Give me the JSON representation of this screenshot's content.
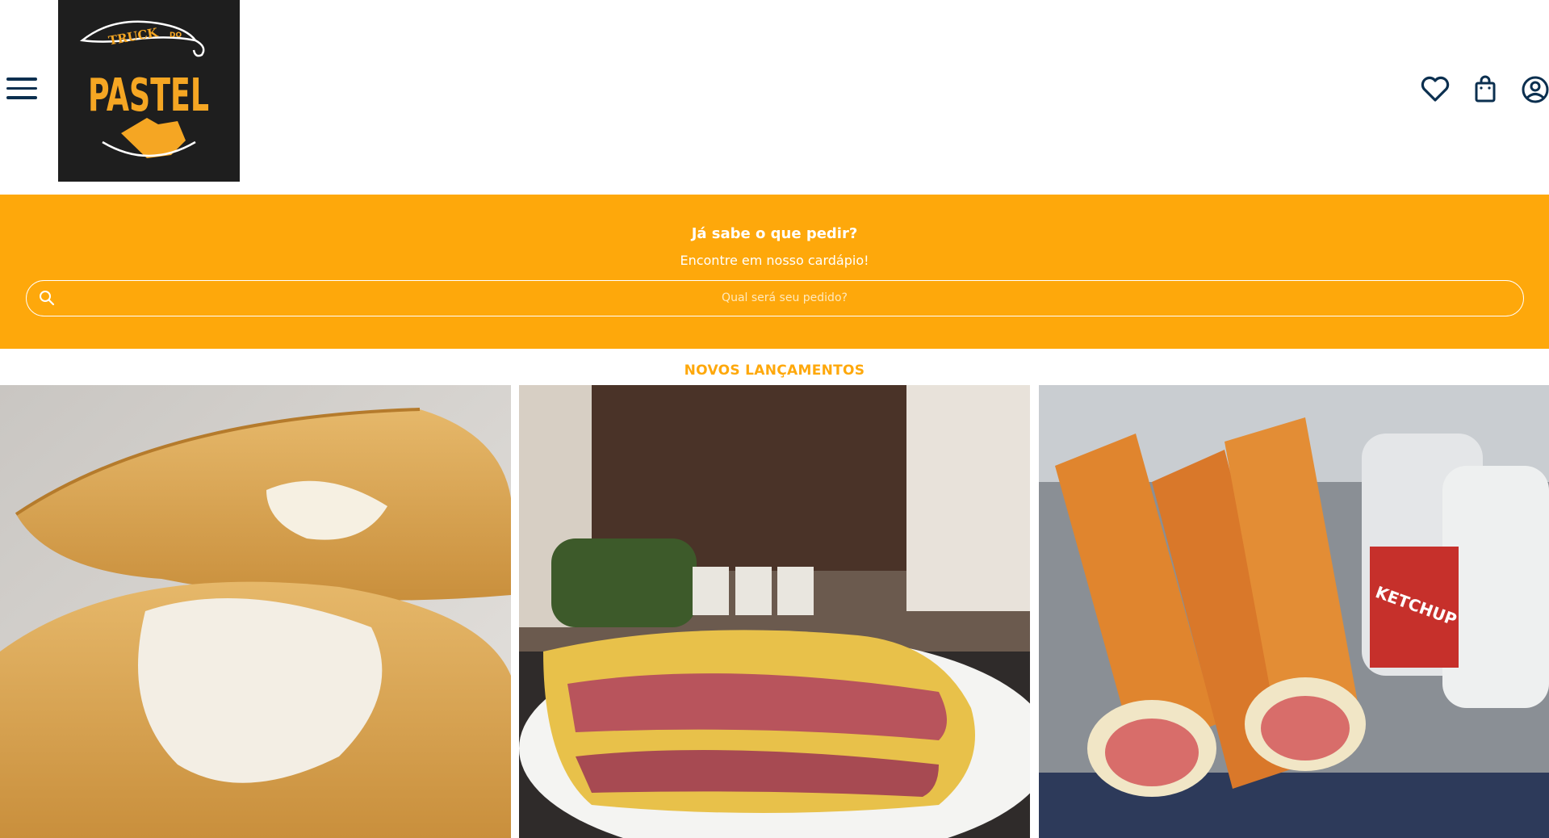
{
  "header": {
    "menu_icon": "hamburger-menu-icon",
    "logo": {
      "top_text": "TRUCK",
      "small_text": "DO",
      "main_text": "PASTEL"
    },
    "actions": [
      {
        "icon": "heart-icon"
      },
      {
        "icon": "shopping-bag-icon"
      },
      {
        "icon": "user-circle-icon"
      }
    ]
  },
  "banner": {
    "title": "Já sabe o que pedir?",
    "subtitle": "Encontre em nosso cardápio!",
    "search_placeholder": "Qual será seu pedido?"
  },
  "section": {
    "title": "NOVOS LANÇAMENTOS",
    "cards": [
      {
        "image": "pastel-with-cheese-filling-photo"
      },
      {
        "image": "pastel-with-ham-filling-photo"
      },
      {
        "image": "hot-dog-pastel-rolls-photo",
        "bottle_label": "KETCHUP"
      }
    ]
  },
  "colors": {
    "brand_orange": "#fea80b",
    "navy": "#0b2f4f",
    "logo_bg": "#1e1e1e",
    "logo_yellow": "#f5a623"
  }
}
